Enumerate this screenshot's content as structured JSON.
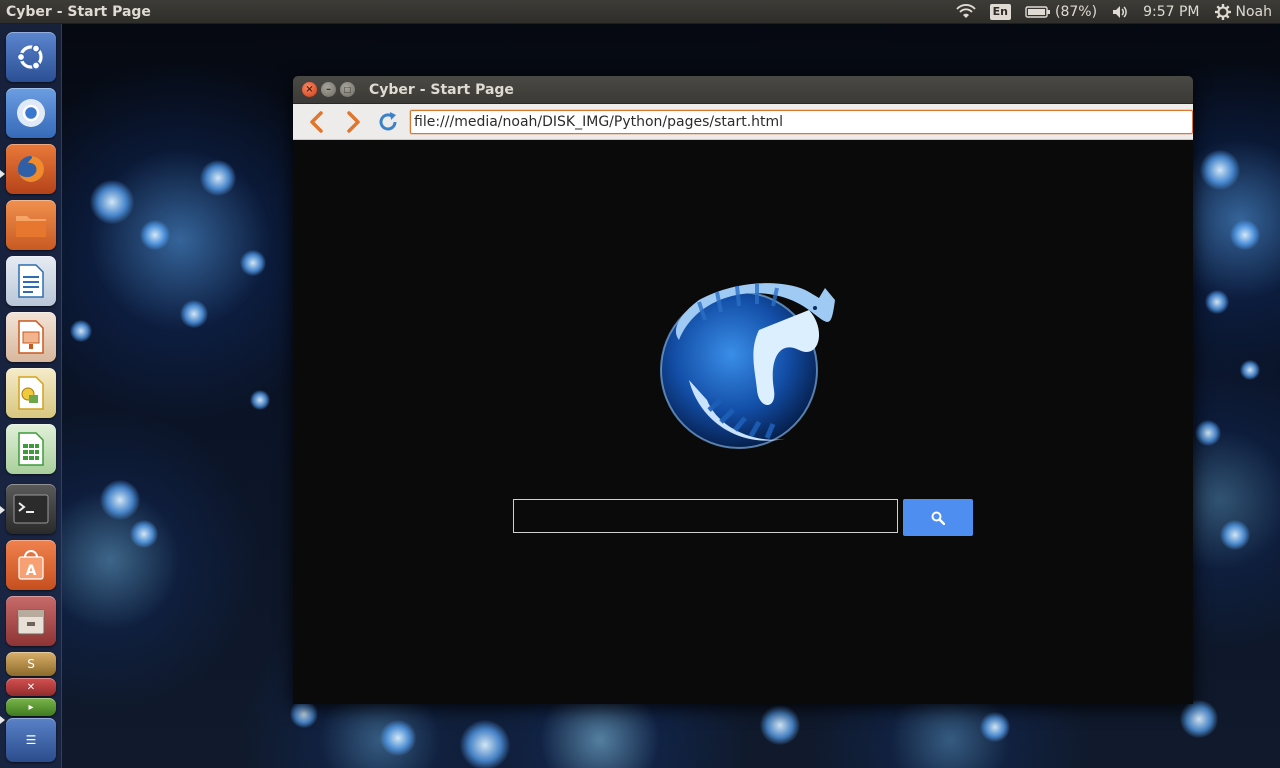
{
  "panel": {
    "app_title": "Cyber - Start Page",
    "language": "En",
    "battery": "(87%)",
    "clock": "9:57 PM",
    "user": "Noah",
    "icons": [
      "wifi-icon",
      "battery-icon",
      "volume-icon",
      "gear-icon"
    ]
  },
  "launcher": {
    "items": [
      {
        "name": "ubuntu-dash",
        "icon": "ubuntu-logo-icon",
        "color": "#3b68b8"
      },
      {
        "name": "chromium",
        "icon": "chromium-icon",
        "color": "#4a84d4"
      },
      {
        "name": "firefox",
        "icon": "firefox-icon",
        "color": "#d35a1f"
      },
      {
        "name": "files",
        "icon": "folder-icon",
        "color": "#e0702f"
      },
      {
        "name": "libreoffice-writer",
        "icon": "writer-icon",
        "color": "#2e6db0"
      },
      {
        "name": "libreoffice-impress",
        "icon": "impress-icon",
        "color": "#c9581f"
      },
      {
        "name": "libreoffice-draw",
        "icon": "draw-icon",
        "color": "#d2a21e"
      },
      {
        "name": "libreoffice-calc",
        "icon": "calc-icon",
        "color": "#3e9a3a"
      },
      {
        "name": "terminal",
        "icon": "terminal-icon",
        "color": "#2c2c2c"
      },
      {
        "name": "software-center",
        "icon": "software-center-icon",
        "color": "#e0632c"
      },
      {
        "name": "archive-manager",
        "icon": "archive-icon",
        "color": "#b04a4a"
      }
    ],
    "stacked": [
      "stacked-app-icon",
      "stacked-app-icon",
      "stacked-app-icon",
      "stacked-app-icon"
    ]
  },
  "window": {
    "title": "Cyber - Start Page",
    "url": "file:///media/noah/DISK_IMG/Python/pages/start.html",
    "accent": "#e0752e"
  },
  "page": {
    "search_placeholder": "",
    "search_button_color": "#4d8ef0",
    "logo_icon": "cyber-cat-globe-logo"
  }
}
